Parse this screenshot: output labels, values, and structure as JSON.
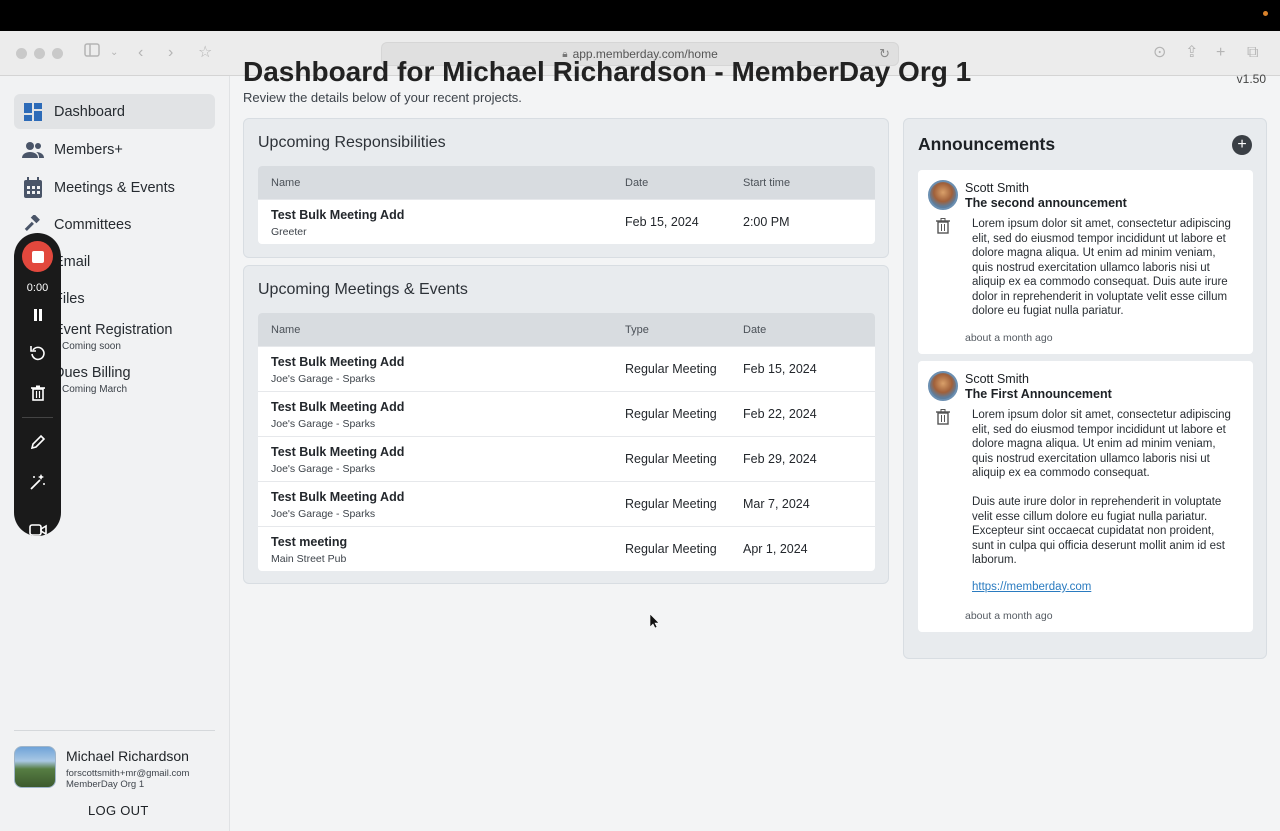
{
  "browser": {
    "url": "app.memberday.com/home"
  },
  "sidebar": {
    "items": [
      {
        "label": "Dashboard",
        "icon": "dashboard-icon"
      },
      {
        "label": "Members+",
        "icon": "people-icon"
      },
      {
        "label": "Meetings & Events",
        "icon": "calendar-icon"
      },
      {
        "label": "Committees",
        "icon": "gavel-icon"
      },
      {
        "label": "Email",
        "icon": "mail-icon"
      },
      {
        "label": "Files",
        "icon": "folder-icon"
      },
      {
        "label": "Event Registration",
        "sub": "Coming soon",
        "icon": "ticket-icon"
      },
      {
        "label": "Dues Billing",
        "sub": "Coming March",
        "icon": "billing-icon"
      }
    ],
    "recorder_visible_labels": [
      "mail",
      "iles",
      "vent Registration",
      "oming soon",
      "ues Billing",
      "oming March"
    ],
    "user": {
      "name": "Michael Richardson",
      "email": "forscottsmith+mr@gmail.com",
      "org": "MemberDay Org 1",
      "logout": "LOG OUT"
    }
  },
  "recorder": {
    "time": "0:00"
  },
  "header": {
    "title": "Dashboard for Michael Richardson - MemberDay Org 1",
    "subtitle": "Review the details below of your recent projects.",
    "version": "v1.50"
  },
  "responsibilities": {
    "title": "Upcoming Responsibilities",
    "columns": [
      "Name",
      "Date",
      "Start time"
    ],
    "rows": [
      {
        "name": "Test Bulk Meeting Add",
        "sub": "Greeter",
        "date": "Feb 15, 2024",
        "time": "2:00 PM"
      }
    ]
  },
  "meetings": {
    "title": "Upcoming Meetings & Events",
    "columns": [
      "Name",
      "Type",
      "Date"
    ],
    "rows": [
      {
        "name": "Test Bulk Meeting Add",
        "sub": "Joe's Garage - Sparks",
        "type": "Regular Meeting",
        "date": "Feb 15, 2024"
      },
      {
        "name": "Test Bulk Meeting Add",
        "sub": "Joe's Garage - Sparks",
        "type": "Regular Meeting",
        "date": "Feb 22, 2024"
      },
      {
        "name": "Test Bulk Meeting Add",
        "sub": "Joe's Garage - Sparks",
        "type": "Regular Meeting",
        "date": "Feb 29, 2024"
      },
      {
        "name": "Test Bulk Meeting Add",
        "sub": "Joe's Garage - Sparks",
        "type": "Regular Meeting",
        "date": "Mar 7, 2024"
      },
      {
        "name": "Test meeting",
        "sub": "Main Street Pub",
        "type": "Regular Meeting",
        "date": "Apr 1, 2024"
      }
    ]
  },
  "announcements": {
    "title": "Announcements",
    "items": [
      {
        "author": "Scott Smith",
        "headline": "The second announcement",
        "body": "Lorem ipsum dolor sit amet, consectetur adipiscing elit, sed do eiusmod tempor incididunt ut labore et dolore magna aliqua. Ut enim ad minim veniam, quis nostrud exercitation ullamco laboris nisi ut aliquip ex ea commodo consequat. Duis aute irure dolor in reprehenderit in voluptate velit esse cillum dolore eu fugiat nulla pariatur.",
        "time": "about a month ago"
      },
      {
        "author": "Scott Smith",
        "headline": "The First Announcement",
        "body": "Lorem ipsum dolor sit amet, consectetur adipiscing elit, sed do eiusmod tempor incididunt ut labore et dolore magna aliqua. Ut enim ad minim veniam, quis nostrud exercitation ullamco laboris nisi ut aliquip ex ea commodo consequat.",
        "body2": "Duis aute irure dolor in reprehenderit in voluptate velit esse cillum dolore eu fugiat nulla pariatur. Excepteur sint occaecat cupidatat non proident, sunt in culpa qui officia deserunt mollit anim id est laborum.",
        "link": "https://memberday.com",
        "time": "about a month ago"
      }
    ]
  }
}
